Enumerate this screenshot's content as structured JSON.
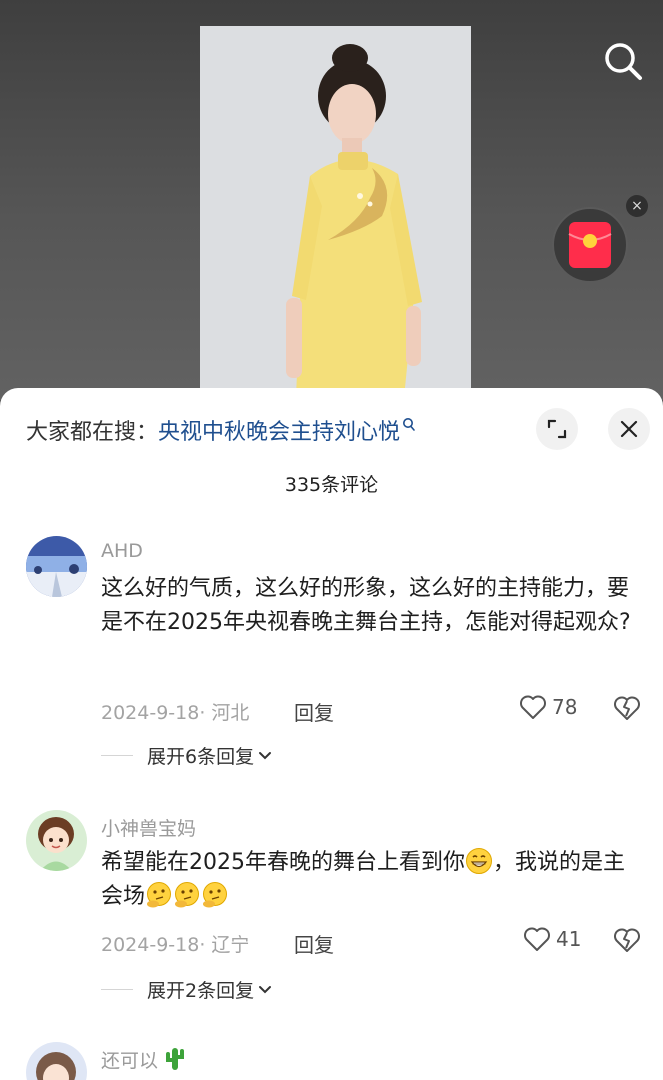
{
  "video": {
    "search_icon": "search-icon",
    "redpacket_icon": "red-envelope-icon",
    "redpacket_close": "×"
  },
  "sheet": {
    "trend_prefix": "大家都在搜：",
    "trend_keyword": "央视中秋晚会主持刘心悦",
    "comment_count": "335条评论",
    "colors": {
      "keyword": "#1f4f8f",
      "meta": "#a3a3a3",
      "username": "#9a9a9a"
    }
  },
  "comments": [
    {
      "username": "AHD",
      "text": "这么好的气质，这么好的形象，这么好的主持能力，要是不在2025年央视春晚主舞台主持，怎能对得起观众?",
      "meta": "2024-9-18· 河北",
      "reply_label": "回复",
      "likes": "78",
      "more_replies": "展开6条回复"
    },
    {
      "username": "小神兽宝妈",
      "text_a": "希望能在2025年春晚的舞台上看到你",
      "text_b": "，我说的是主会场",
      "meta": "2024-9-18· 辽宁",
      "reply_label": "回复",
      "likes": "41",
      "more_replies": "展开2条回复"
    },
    {
      "username": "还可以"
    }
  ]
}
